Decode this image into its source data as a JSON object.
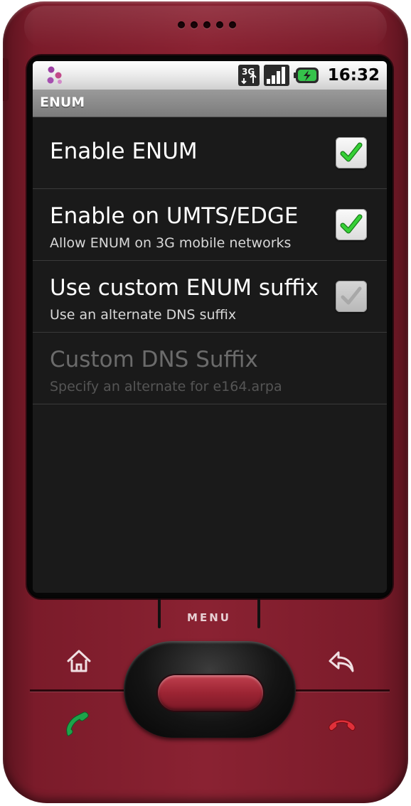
{
  "status_bar": {
    "network_badge": "3G",
    "time": "16:32",
    "icons": [
      "app-notification-icon",
      "3g-icon",
      "signal-icon",
      "battery-icon"
    ]
  },
  "title_bar": {
    "title": "ENUM"
  },
  "preferences": [
    {
      "title": "Enable ENUM",
      "summary": "",
      "checked": true,
      "enabled": true
    },
    {
      "title": "Enable on UMTS/EDGE",
      "summary": "Allow ENUM on 3G mobile networks",
      "checked": true,
      "enabled": true
    },
    {
      "title": "Use custom ENUM suffix",
      "summary": "Use an alternate DNS suffix",
      "checked": false,
      "enabled": true
    },
    {
      "title": "Custom DNS Suffix",
      "summary": "Specify an alternate for e164.arpa",
      "enabled": false
    }
  ],
  "hardware": {
    "menu_label": "MENU",
    "buttons": [
      "home-icon",
      "back-icon",
      "call-icon",
      "end-call-icon",
      "trackball"
    ]
  },
  "colors": {
    "phone_body": "#7b1b2a",
    "check_green": "#2fbf2f",
    "screen_bg": "#1a1a1a"
  }
}
